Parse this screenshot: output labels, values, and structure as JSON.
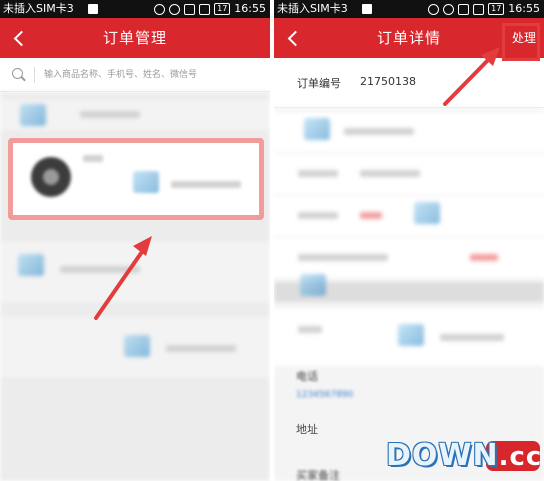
{
  "left_screen": {
    "status_bar": {
      "carrier": "未插入SIM卡3",
      "battery": "17",
      "time": "16:55"
    },
    "title": "订单管理",
    "search": {
      "placeholder": "输入商品名称、手机号、姓名、微信号"
    }
  },
  "right_screen": {
    "status_bar": {
      "carrier": "未插入SIM卡3",
      "battery": "17",
      "time": "16:55"
    },
    "title": "订单详情",
    "action_label": "处理",
    "order_number": {
      "label": "订单编号",
      "value": "21750138"
    },
    "fields": {
      "phone_label": "电话",
      "address_label": "地址",
      "remark_label": "买家备注"
    }
  },
  "watermark": {
    "text": "DOWN",
    "badge": ".cc"
  },
  "colors": {
    "accent": "#d9272e",
    "arrow": "#e23c3c",
    "link": "#3a7ec8"
  },
  "icons": {
    "back": "chevron-left-icon",
    "search": "search-icon",
    "signal": "wifi-icon",
    "alarm": "alarm-icon"
  }
}
